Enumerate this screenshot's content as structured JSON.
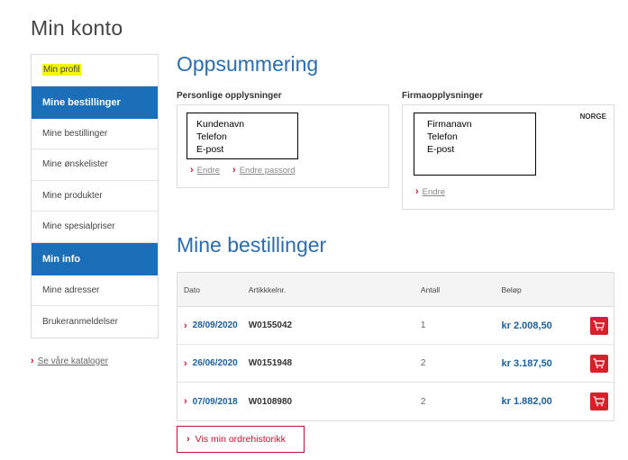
{
  "page": {
    "title": "Min konto"
  },
  "sidebar": {
    "items": [
      {
        "label": "Min profil",
        "type": "highlight"
      },
      {
        "label": "Mine bestillinger",
        "type": "header"
      },
      {
        "label": "Mine bestillinger",
        "type": "link"
      },
      {
        "label": "Mine ønskelister",
        "type": "link"
      },
      {
        "label": "Mine produkter",
        "type": "link"
      },
      {
        "label": "Mine spesialpriser",
        "type": "link"
      },
      {
        "label": "Min info",
        "type": "header"
      },
      {
        "label": "Mine adresser",
        "type": "link"
      },
      {
        "label": "Brukeranmeldelser",
        "type": "link"
      }
    ],
    "catalog_link": "Se våre kataloger"
  },
  "summary": {
    "title": "Oppsummering",
    "personal": {
      "title": "Personlige opplysninger",
      "lines": [
        "Kundenavn",
        "Telefon",
        "E-post"
      ],
      "edit_label": "Endre",
      "password_label": "Endre passord"
    },
    "company": {
      "title": "Firmaopplysninger",
      "country": "NORGE",
      "lines": [
        "Firmanavn",
        "Telefon",
        "E-post"
      ],
      "edit_label": "Endre"
    }
  },
  "orders": {
    "title": "Mine bestillinger",
    "headers": {
      "date": "Dato",
      "article": "Artikkkelnr.",
      "qty": "Antall",
      "amount": "Beløp"
    },
    "rows": [
      {
        "date": "28/09/2020",
        "article": "W0155042",
        "qty": "1",
        "amount": "kr 2.008,50"
      },
      {
        "date": "26/06/2020",
        "article": "W0151948",
        "qty": "2",
        "amount": "kr 3.187,50"
      },
      {
        "date": "07/09/2018",
        "article": "W0108980",
        "qty": "2",
        "amount": "kr 1.882,00"
      }
    ],
    "history_button": "Vis min ordrehistorikk"
  },
  "icons": {
    "chevron": "chevron-right-icon",
    "cart": "cart-icon"
  },
  "colors": {
    "accent_blue": "#1a6fb8",
    "heading_blue": "#2b6cb0",
    "accent_red": "#d91f2a",
    "highlight": "#f5f50a"
  }
}
